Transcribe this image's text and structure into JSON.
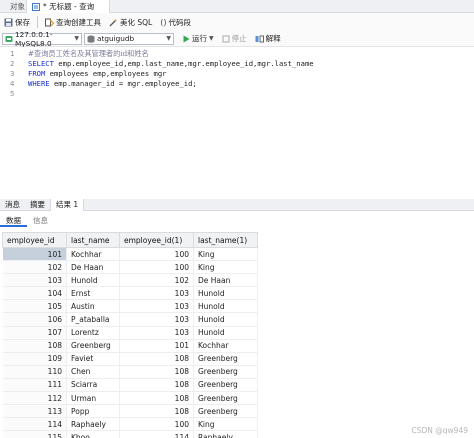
{
  "window": {
    "tab_objects": "对象",
    "tab_query": "* 无标题 - 查询"
  },
  "toolbar": {
    "save": "保存",
    "query_builder": "查询创建工具",
    "beautify": "美化 SQL",
    "snippet": "代码段"
  },
  "connection": {
    "server": "127.0.0.1-MySQL8.0",
    "database": "atguigudb",
    "run": "运行",
    "stop": "停止",
    "explain": "解释"
  },
  "editor": {
    "line_numbers": [
      "1",
      "2",
      "3",
      "4",
      "5"
    ],
    "comment": "#查询员工姓名及其管理者的id和姓名",
    "line2_kw": "SELECT",
    "line2_rest": " emp.employee_id,emp.last_name,mgr.employee_id,mgr.last_name",
    "line3_kw": "FROM",
    "line3_rest": " employees emp,employees mgr",
    "line4_kw": "WHERE",
    "line4_rest": " emp.manager_id = mgr.employee_id;"
  },
  "result_tabs": [
    "消息",
    "摘要",
    "结果 1"
  ],
  "sub_tabs": [
    "数据",
    "信息"
  ],
  "grid": {
    "columns": [
      "employee_id",
      "last_name",
      "employee_id(1)",
      "last_name(1)"
    ],
    "rows": [
      [
        "101",
        "Kochhar",
        "100",
        "King"
      ],
      [
        "102",
        "De Haan",
        "100",
        "King"
      ],
      [
        "103",
        "Hunold",
        "102",
        "De Haan"
      ],
      [
        "104",
        "Ernst",
        "103",
        "Hunold"
      ],
      [
        "105",
        "Austin",
        "103",
        "Hunold"
      ],
      [
        "106",
        "P_ataballa",
        "103",
        "Hunold"
      ],
      [
        "107",
        "Lorentz",
        "103",
        "Hunold"
      ],
      [
        "108",
        "Greenberg",
        "101",
        "Kochhar"
      ],
      [
        "109",
        "Faviet",
        "108",
        "Greenberg"
      ],
      [
        "110",
        "Chen",
        "108",
        "Greenberg"
      ],
      [
        "111",
        "Sciarra",
        "108",
        "Greenberg"
      ],
      [
        "112",
        "Urman",
        "108",
        "Greenberg"
      ],
      [
        "113",
        "Popp",
        "108",
        "Greenberg"
      ],
      [
        "114",
        "Raphaely",
        "100",
        "King"
      ],
      [
        "115",
        "Khoo",
        "114",
        "Raphaely"
      ]
    ]
  },
  "watermark": "CSDN @qw949",
  "colors": {
    "accent": "#2b6dd8",
    "keyword": "#1a2fcf",
    "selected_cell": "#c6cfdc"
  }
}
